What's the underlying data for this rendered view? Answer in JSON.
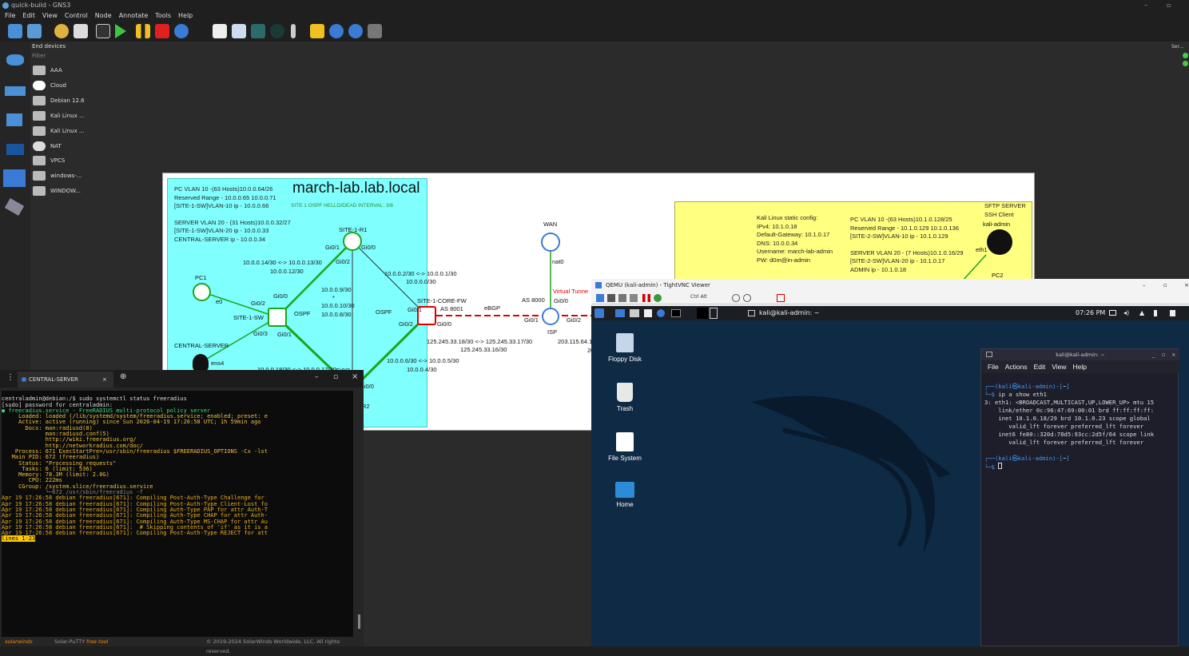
{
  "app": {
    "title": "quick-build - GNS3",
    "menus": [
      "File",
      "Edit",
      "View",
      "Control",
      "Node",
      "Annotate",
      "Tools",
      "Help"
    ]
  },
  "devices": {
    "header": "End devices",
    "filter": "Filter",
    "items": [
      "AAA",
      "Cloud",
      "Debian 12.6",
      "Kali Linux ...",
      "Kali Linux ...",
      "NAT",
      "VPCS",
      "windows-...",
      "WINDOW..."
    ]
  },
  "right_panel": {
    "label": "Ser..."
  },
  "topology": {
    "domain_title": "march-lab.lab.local",
    "ospf_note": "SITE 1 OSPF HELLO/DEAD INTERVAL: 3/6",
    "site1_notes": [
      "PC VLAN 10 -(63 Hosts)10.0.0.64/26",
      "Reserved Range - 10.0.0.65 10.0.0.71",
      "[SITE-1-SW]VLAN-10 ip - 10.0.0.66",
      "",
      "SERVER VLAN 20 - (31 Hosts)10.0.0.32/27",
      "[SITE-1-SW]VLAN-20 ip - 10.0.0.33",
      "CENTRAL-SERVER ip - 10.0.0.34"
    ],
    "kali_config": [
      "Kali Linux static config:",
      "IPv4: 10.1.0.18",
      "Default-Gateway: 10.1.0.17",
      "DNS: 10.0.0.34",
      "Username: march-lab-admin",
      "PW: d0m@in-admin"
    ],
    "site2_notes": [
      "PC VLAN 10 -(63 Hosts)10.1.0.128/25",
      "Reserved Range - 10.1.0.129 10.1.0.136",
      "[SITE-2-SW]VLAN-10 ip - 10.1.0.129",
      "",
      "SERVER VLAN 20 - (7 Hosts)10.1.0.16/29",
      "[SITE-2-SW]VLAN-20 ip - 10.1.0.17",
      "ADMIN ip - 10.1.0.18"
    ],
    "sftp_notes": [
      "SFTP SERVER",
      "SSH Client"
    ],
    "labels": {
      "r1": "SITE-1-R1",
      "sw": "SITE-1-SW",
      "pc1": "PC1",
      "central": "CENTRAL-SERVER",
      "fw": "SITE-1-CORE-FW",
      "as8001": "AS 8001",
      "wan": "WAN",
      "isp": "ISP",
      "as8000": "AS 8000",
      "ebgp": "eBGP",
      "vt": "Virtual Tunne",
      "kali_admin": "kali-admin",
      "pc2": "PC2",
      "nat0": "nat0",
      "eth1": "eth1",
      "ospf1": "OSPF",
      "ospf2": "OSPF",
      "r2suffix": "R2",
      "l_gi01a": "Gi0/1",
      "l_gi02a": "Gi0/2",
      "l_gi00a": "Gi0/0",
      "l_e0": "e0",
      "l_gi02b": "Gi0/2",
      "l_gi00b": "Gi0/0",
      "l_gi03": "Gi0/3",
      "l_gi01b": "Gi0/1",
      "l_ens4": "ens4",
      "l_gi01c": "Gi0/1",
      "l_gi02c": "Gi0/2",
      "l_gi00c": "Gi0/0",
      "l_gi00d": "Gi0/0",
      "l_gi01d": "Gi0/1",
      "l_gi02d": "Gi0/2",
      "l_gi00e": "Gi0/0",
      "l_gi02e": "Gi0/2",
      "n1": "10.0.0.14/30 <-> 10.0.0.13/30",
      "n1b": "10.0.0.12/30",
      "n2": "10.0.0.9/30",
      "n2s": "*",
      "n3": "10.0.0.10/30",
      "n4": "10.0.0.8/30",
      "n5": "10.0.0.2/30 <-> 10.0.0.1/30",
      "n5b": "10.0.0.0/30",
      "n6": "10.0.0.18/30 <-> 10.0.0.17/30",
      "n7": "125.245.33.18/30 <-> 125.245.33.17/30",
      "n7b": "125.245.33.16/30",
      "n8": "10.0.0.6/30 <-> 10.0.0.5/30",
      "n8b": "10.0.0.4/30",
      "n9": "203.115.64.1",
      "n9b": "20"
    }
  },
  "putty": {
    "tab": "CENTRAL-SERVER",
    "footer_brand": "solarwinds",
    "footer_app": "Solar-PuTTY",
    "footer_free": "free tool",
    "footer_copy": "© 2019-2024 SolarWinds Worldwide, LLC. All rights reserved.",
    "lines": [
      "centraladmin@debian:/$ sudo systemctl status freeradius",
      "[sudo] password for centraladmin:",
      "● freeradius.service - FreeRADIUS multi-protocol policy server",
      "     Loaded: loaded (/lib/systemd/system/freeradius.service; enabled; preset: e",
      "     Active: active (running) since Sun 2026-04-19 17:26:58 UTC; 1h 59min ago",
      "       Docs: man:radiusd(8)",
      "             man:radiusd.conf(5)",
      "             http://wiki.freeradius.org/",
      "             http://networkradius.com/doc/",
      "    Process: 671 ExecStartPre=/usr/sbin/freeradius $FREERADIUS_OPTIONS -Cx -lst",
      "   Main PID: 672 (freeradius)",
      "     Status: \"Processing requests\"",
      "      Tasks: 6 (limit: 536)",
      "     Memory: 78.3M (limit: 2.0G)",
      "        CPU: 222ms",
      "     CGroup: /system.slice/freeradius.service",
      "             └─672 /usr/sbin/freeradius -f",
      "",
      "Apr 19 17:26:58 debian freeradius[671]: Compiling Post-Auth-Type Challenge for ",
      "Apr 19 17:26:58 debian freeradius[671]: Compiling Post-Auth-Type Client-Lost fo",
      "Apr 19 17:26:58 debian freeradius[671]: Compiling Auth-Type PAP for attr Auth-T",
      "Apr 19 17:26:58 debian freeradius[671]: Compiling Auth-Type CHAP for attr Auth-",
      "Apr 19 17:26:58 debian freeradius[671]: Compiling Auth-Type MS-CHAP for attr Au",
      "Apr 19 17:26:58 debian freeradius[671]:  # Skipping contents of 'if' as it is a",
      "Apr 19 17:26:58 debian freeradius[671]: Compiling Post-Auth-Type REJECT for att",
      "lines 1-23"
    ]
  },
  "vnc": {
    "title": "QEMU (kali-admin) - TightVNC Viewer",
    "tool_text": "Ctrl Alt",
    "panel_title": "kali@kali-admin: ~",
    "clock": "07:26 PM",
    "desktop_icons": [
      "Floppy Disk",
      "Trash",
      "File System",
      "Home"
    ],
    "term": {
      "title": "kali@kali-admin: ~",
      "menu": [
        "File",
        "Actions",
        "Edit",
        "View",
        "Help"
      ],
      "prompt_user": "kali㉿kali-admin",
      "prompt_dir": "~",
      "cmd": "ip a show eth1",
      "out1": "3: eth1: <BROADCAST,MULTICAST,UP,LOWER_UP> mtu 15",
      "out2": "    link/ether 0c:96:47:69:00:01 brd ff:ff:ff:ff:",
      "out3": "    inet 10.1.0.18/29 brd 10.1.0.23 scope global",
      "out4": "       valid_lft forever preferred_lft forever",
      "out5": "    inet6 fe80::320d:78d5:93cc:2d5f/64 scope link",
      "out6": "       valid_lft forever preferred_lft forever"
    }
  },
  "colors": {
    "accent": "#00b0d0",
    "ospf_area": "#80ffff",
    "site2_area": "#ffff80",
    "link_green": "#1aa51a"
  }
}
